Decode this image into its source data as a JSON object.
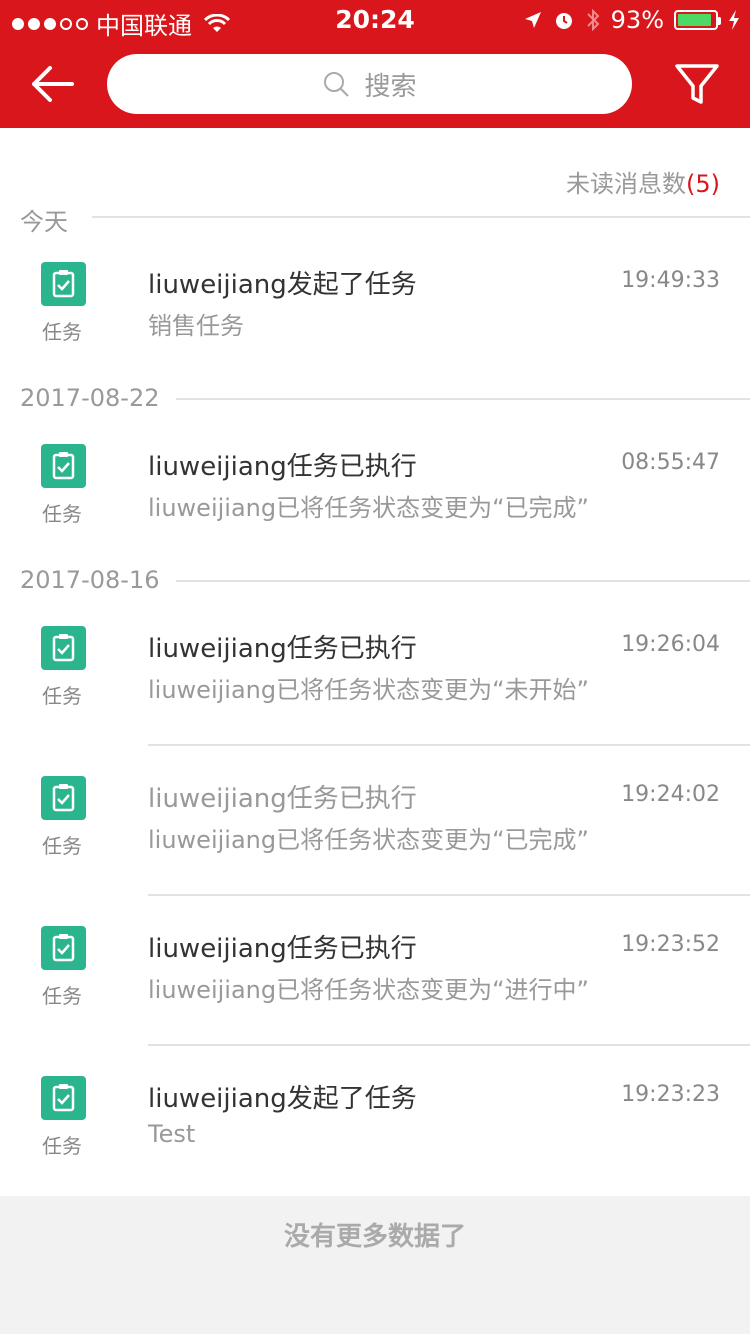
{
  "status_bar": {
    "carrier": "中国联通",
    "time": "20:24",
    "battery": "93%"
  },
  "nav": {
    "search_placeholder": "搜索"
  },
  "unread": {
    "label": "未读消息数",
    "count": "(5)"
  },
  "groups": [
    {
      "date": "今天"
    },
    {
      "date": "2017-08-22"
    },
    {
      "date": "2017-08-16"
    }
  ],
  "items": [
    {
      "icon_label": "任务",
      "title": "liuweijiang发起了任务",
      "time": "19:49:33",
      "desc": "销售任务"
    },
    {
      "icon_label": "任务",
      "title": "liuweijiang任务已执行",
      "time": "08:55:47",
      "desc": "liuweijiang已将任务状态变更为“已完成”"
    },
    {
      "icon_label": "任务",
      "title": "liuweijiang任务已执行",
      "time": "19:26:04",
      "desc": "liuweijiang已将任务状态变更为“未开始”"
    },
    {
      "icon_label": "任务",
      "title": "liuweijiang任务已执行",
      "time": "19:24:02",
      "desc": "liuweijiang已将任务状态变更为“已完成”"
    },
    {
      "icon_label": "任务",
      "title": "liuweijiang任务已执行",
      "time": "19:23:52",
      "desc": "liuweijiang已将任务状态变更为“进行中”"
    },
    {
      "icon_label": "任务",
      "title": "liuweijiang发起了任务",
      "time": "19:23:23",
      "desc": "Test"
    }
  ],
  "footer": {
    "message": "没有更多数据了"
  },
  "colors": {
    "brand_red": "#d9161b",
    "task_green": "#2bb58e"
  },
  "icons": [
    "back-arrow-icon",
    "search-icon",
    "filter-icon",
    "clipboard-check-icon"
  ]
}
